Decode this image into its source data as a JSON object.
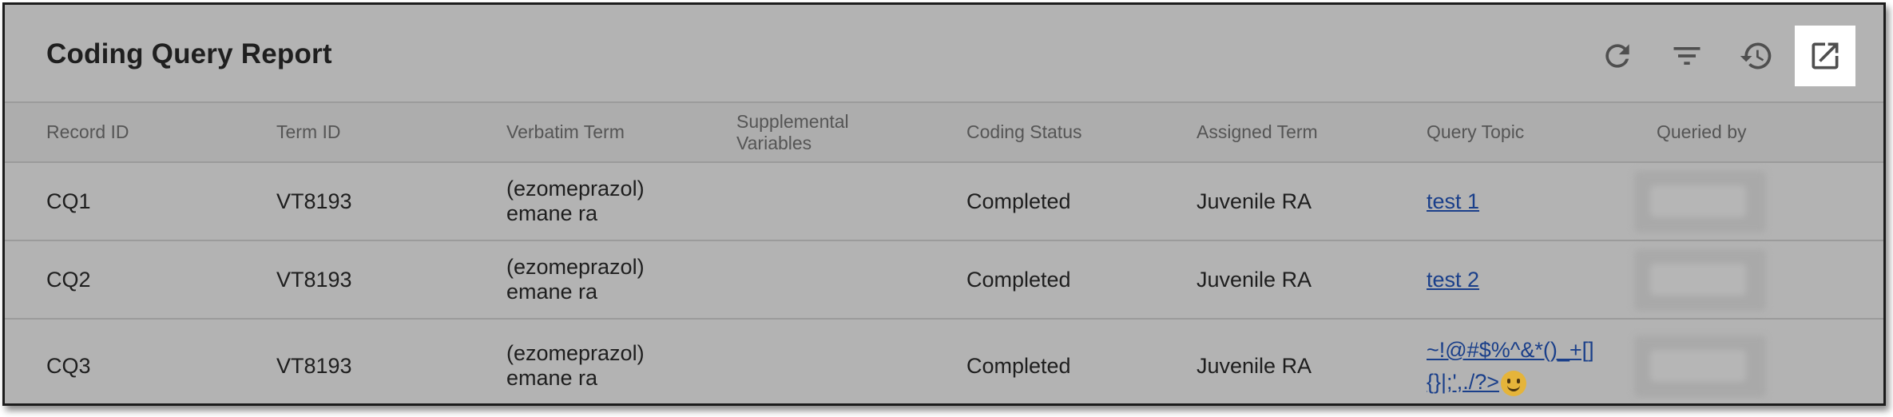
{
  "report": {
    "title": "Coding Query Report"
  },
  "toolbar": {
    "refresh": "refresh-icon",
    "filter": "filter-icon",
    "history": "history-icon",
    "open_external": "open-in-new-icon"
  },
  "table": {
    "columns": [
      "Record ID",
      "Term ID",
      "Verbatim Term",
      "Supplemental\nVariables",
      "Coding Status",
      "Assigned Term",
      "Query Topic",
      "Queried by"
    ],
    "rows": [
      {
        "record_id": "CQ1",
        "term_id": "VT8193",
        "verbatim": "(ezomeprazol)\nemane ra",
        "supplemental": "",
        "status": "Completed",
        "assigned": "Juvenile RA",
        "topic": "test 1"
      },
      {
        "record_id": "CQ2",
        "term_id": "VT8193",
        "verbatim": "(ezomeprazol)\nemane ra",
        "supplemental": "",
        "status": "Completed",
        "assigned": "Juvenile RA",
        "topic": "test 2"
      },
      {
        "record_id": "CQ3",
        "term_id": "VT8193",
        "verbatim": "(ezomeprazol)\nemane ra",
        "supplemental": "",
        "status": "Completed",
        "assigned": "Juvenile RA",
        "topic": "~!@#$%^&*()_+[]\n{}|;',./?>"
      }
    ]
  },
  "colors": {
    "overlay": "#b3b3b3",
    "link": "#1a3f8a",
    "active_tool": "#ffffff"
  }
}
